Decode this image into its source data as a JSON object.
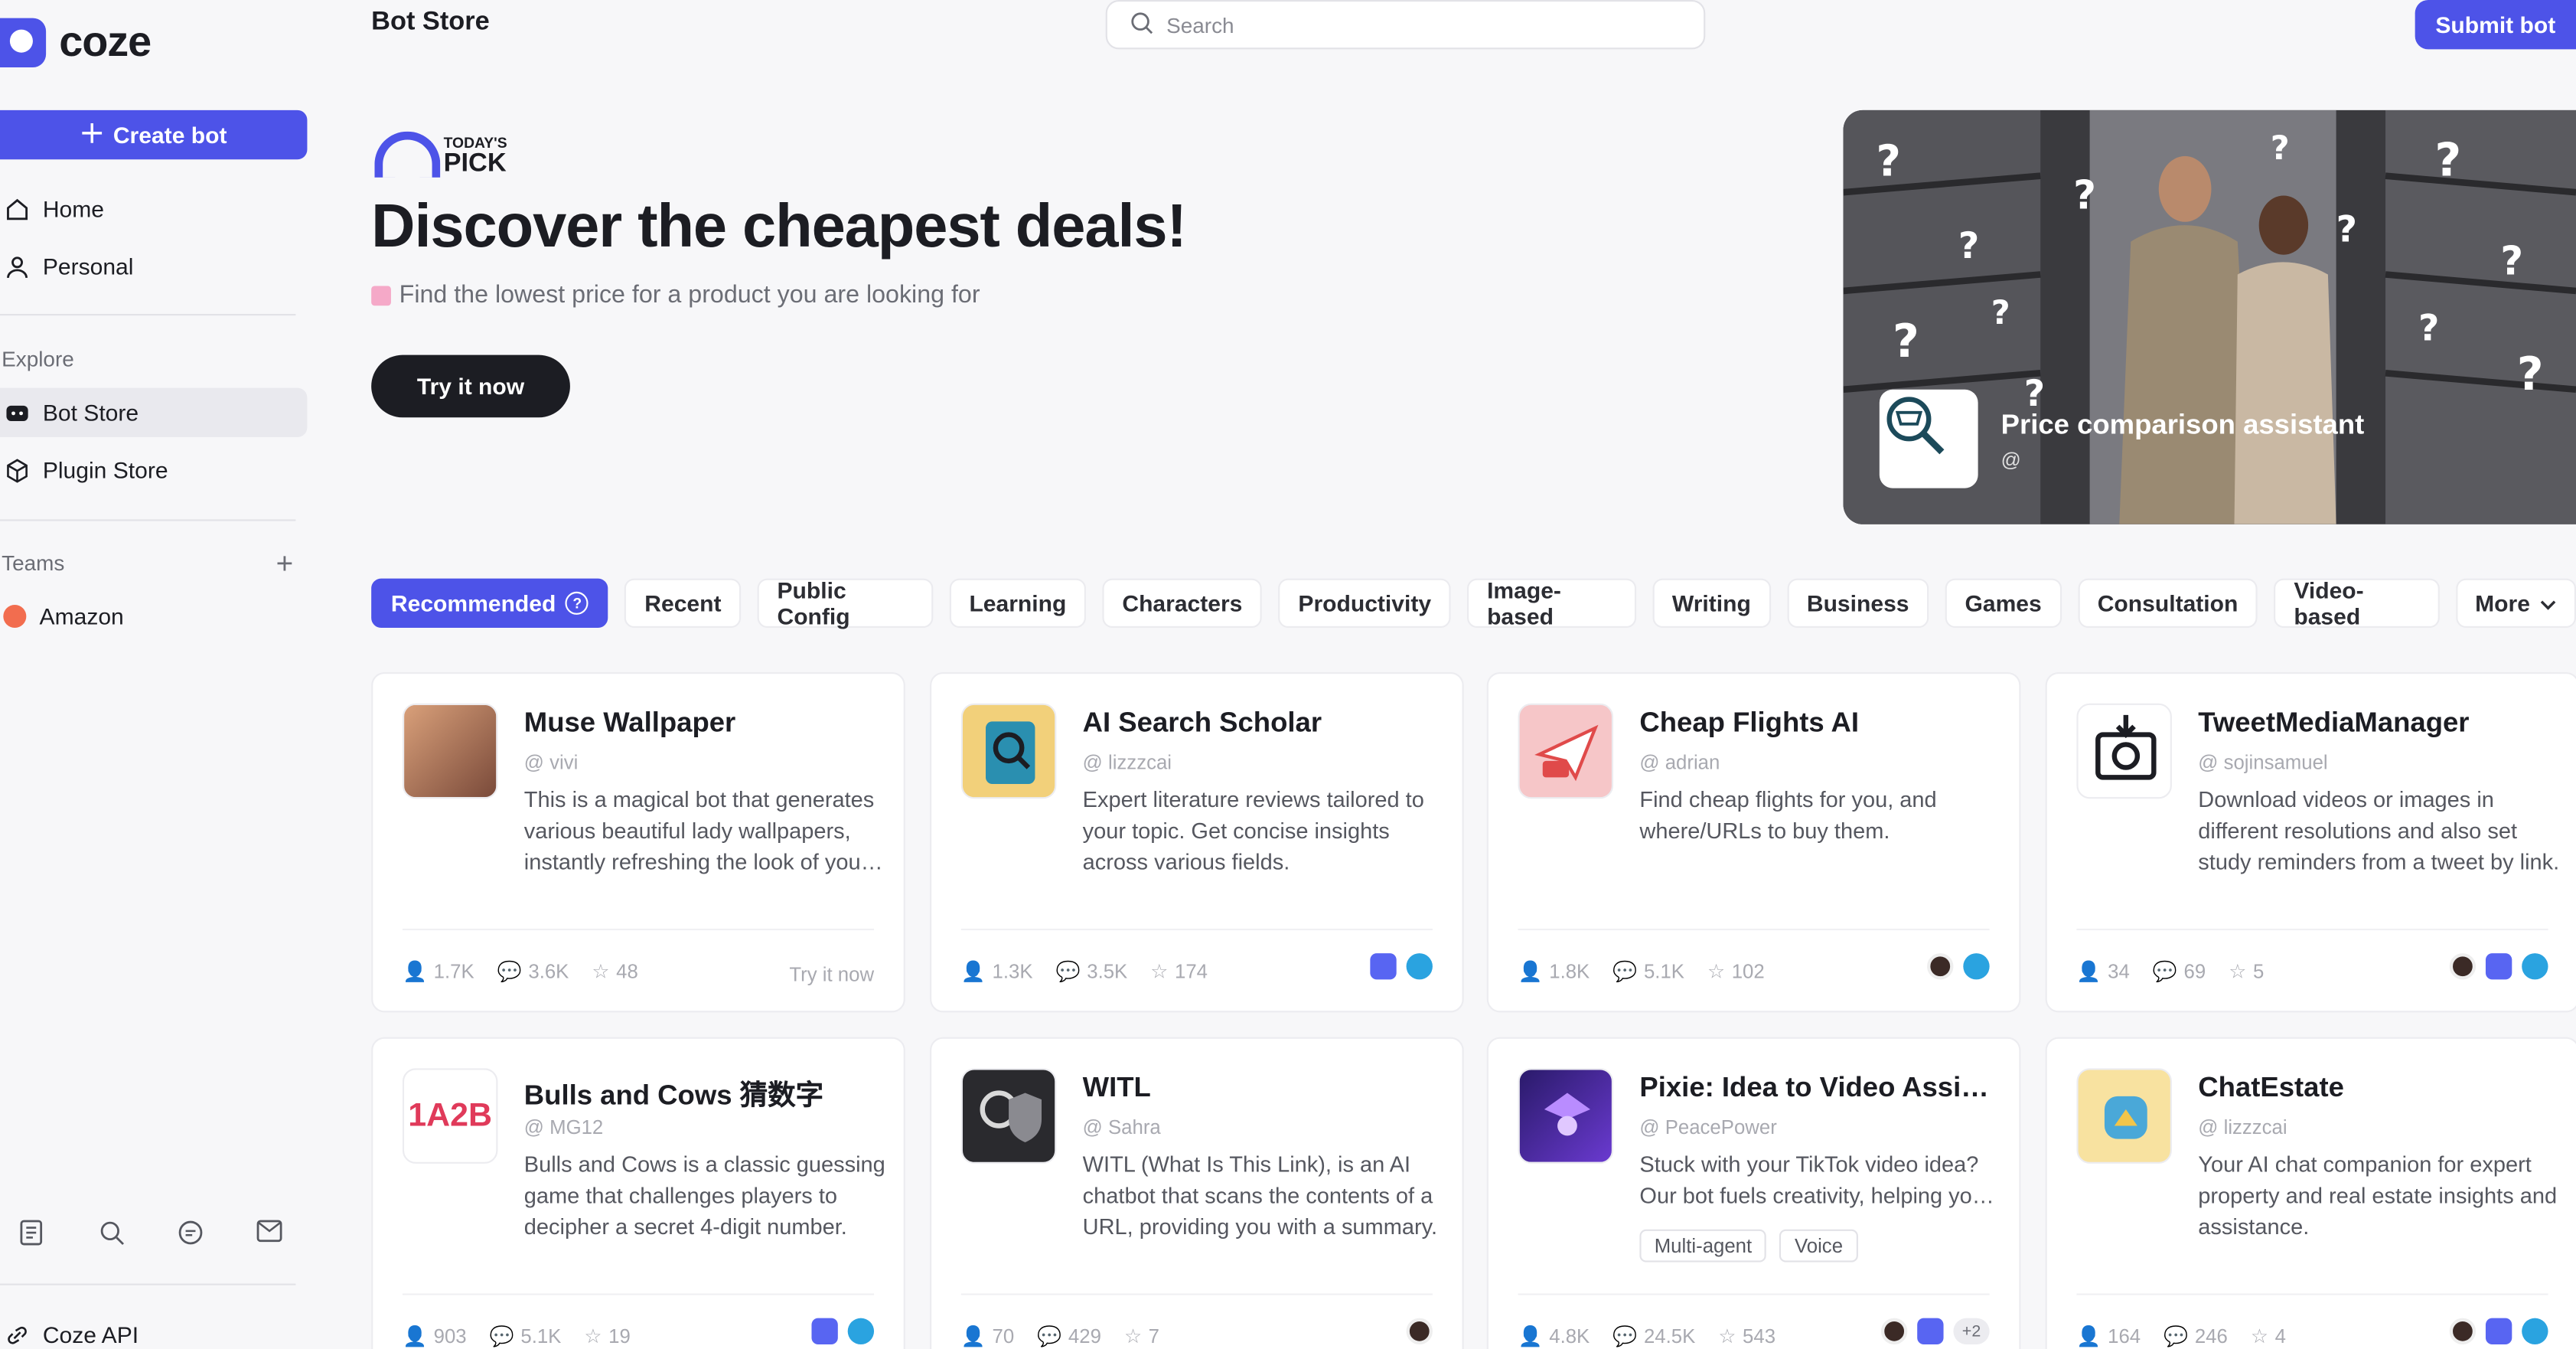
{
  "app": {
    "logo_text": "coze",
    "page_title": "Bot Store"
  },
  "sidebar": {
    "create_label": "Create bot",
    "nav": [
      {
        "label": "Home",
        "icon": "home-icon"
      },
      {
        "label": "Personal",
        "icon": "user-icon"
      }
    ],
    "explore_title": "Explore",
    "explore": [
      {
        "label": "Bot Store",
        "icon": "bot-icon",
        "active": true
      },
      {
        "label": "Plugin Store",
        "icon": "cube-icon"
      }
    ],
    "teams_title": "Teams",
    "teams": [
      {
        "label": "Amazon"
      }
    ],
    "bottom_icons": [
      "document-icon",
      "search-user-icon",
      "chat-icon",
      "mail-icon"
    ],
    "api_label": "Coze API"
  },
  "search": {
    "placeholder": "Search"
  },
  "submit_label": "Submit bot",
  "hero": {
    "badge_small": "TODAY'S",
    "badge_big": "PICK",
    "title": "Discover the cheapest deals!",
    "subtitle": "Find the lowest price for a product you are looking for",
    "cta": "Try it now",
    "bot_name": "Price comparison assistant",
    "bot_at": "@"
  },
  "tabs": [
    "Recommended",
    "Recent",
    "Public Config",
    "Learning",
    "Characters",
    "Productivity",
    "Image-based",
    "Writing",
    "Business",
    "Games",
    "Consultation",
    "Video-based",
    "More"
  ],
  "cards": [
    {
      "name": "Muse Wallpaper",
      "author": "vivi",
      "desc": "This is a magical bot that generates various beautiful lady wallpapers, instantly refreshing the look of your screen and adding a touch of charm.",
      "users": "1.7K",
      "chats": "3.6K",
      "stars": "48",
      "try": "Try it now"
    },
    {
      "name": "AI Search Scholar",
      "author": "lizzzcai",
      "desc": "Expert literature reviews tailored to your topic. Get concise insights across various fields.",
      "users": "1.3K",
      "chats": "3.5K",
      "stars": "174"
    },
    {
      "name": "Cheap Flights AI",
      "author": "adrian",
      "desc": "Find cheap flights for you, and where/URLs to buy them.",
      "users": "1.8K",
      "chats": "5.1K",
      "stars": "102"
    },
    {
      "name": "TweetMediaManager",
      "author": "sojinsamuel",
      "desc": "Download videos or images in different resolutions and also set study reminders from a tweet by link.",
      "users": "34",
      "chats": "69",
      "stars": "5"
    },
    {
      "name": "Bulls and Cows 猜数字",
      "author": "MG12",
      "desc": "Bulls and Cows is a classic guessing game that challenges players to decipher a secret 4-digit number.",
      "users": "903",
      "chats": "5.1K",
      "stars": "19"
    },
    {
      "name": "WITL",
      "author": "Sahra",
      "desc": "WITL (What Is This Link), is an AI chatbot that scans the contents of a URL, providing you with a summary.",
      "users": "70",
      "chats": "429",
      "stars": "7"
    },
    {
      "name": "Pixie: Idea to Video Assistant",
      "author": "PeacePower",
      "desc": "Stuck with your TikTok video idea? Our bot fuels creativity, helping you plan.",
      "tags": [
        "Multi-agent",
        "Voice"
      ],
      "users": "4.8K",
      "chats": "24.5K",
      "stars": "543",
      "more": "+2"
    },
    {
      "name": "ChatEstate",
      "author": "lizzzcai",
      "desc": "Your AI chat companion for expert property and real estate insights and assistance.",
      "users": "164",
      "chats": "246",
      "stars": "4"
    }
  ],
  "colors": {
    "accent": "#4d53e8",
    "discord": "#5865f2",
    "telegram": "#2aa3e0"
  }
}
